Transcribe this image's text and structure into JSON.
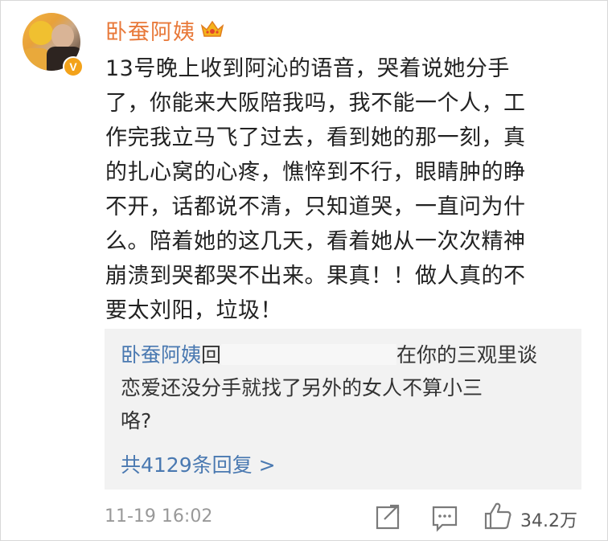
{
  "post": {
    "username": "卧蚕阿姨",
    "badge_letter": "V",
    "body": "13号晚上收到阿沁的语音，哭着说她分手\n了，你能来大阪陪我吗，我不能一个人，工\n作完我立马飞了过去，看到她的那一刻，真\n的扎心窝的心疼，憔悴到不行，眼睛肿的睁\n不开，话都说不清，只知道哭，一直问为什\n么。陪着她的这几天，看着她从一次次精神\n崩溃到哭都哭不出来。果真！！做人真的不\n要太刘阳，垃圾！",
    "timestamp": "11-19 16:02",
    "like_count": "34.2万"
  },
  "reply": {
    "author": "卧蚕阿姨",
    "prefix": "回",
    "text_after_blur": "在你的三观里谈\n恋爱还没分手就找了另外的女人不算小三\n咯?",
    "more_label": "共4129条回复 >"
  },
  "icons": {
    "avatar": "avatar-image",
    "verified": "verified-badge-icon",
    "crown": "crown-icon",
    "share": "share-icon",
    "comment": "comment-icon",
    "like": "thumbs-up-icon"
  },
  "colors": {
    "username": "#e8793a",
    "link": "#4a79b1",
    "reply_bg": "#f2f2f2",
    "verified": "#f3a21a"
  }
}
